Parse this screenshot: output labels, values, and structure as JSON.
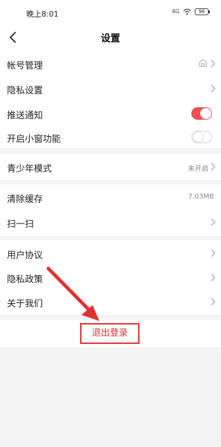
{
  "status_bar": {
    "time": "晚上8:01",
    "signal": "4G",
    "battery": "96"
  },
  "nav": {
    "title": "设置"
  },
  "group1": {
    "items": [
      {
        "label": "帐号管理"
      },
      {
        "label": "隐私设置"
      },
      {
        "label": "推送通知",
        "toggle": "on"
      },
      {
        "label": "开启小窗功能",
        "toggle": "off"
      }
    ]
  },
  "group2": {
    "items": [
      {
        "label": "青少年模式",
        "value": "未开启"
      }
    ]
  },
  "group3": {
    "items": [
      {
        "label": "清除缓存",
        "value": "7.03MB"
      },
      {
        "label": "扫一扫"
      }
    ]
  },
  "group4": {
    "items": [
      {
        "label": "用户协议"
      },
      {
        "label": "隐私政策"
      },
      {
        "label": "关于我们"
      }
    ]
  },
  "logout": {
    "label": "退出登录"
  },
  "colors": {
    "accent": "#ee4e55",
    "highlight": "#e03131"
  },
  "icons": [
    "back-arrow-icon",
    "signal-icon",
    "wifi-icon",
    "battery-icon",
    "shield-icon",
    "chevron-right-icon"
  ]
}
